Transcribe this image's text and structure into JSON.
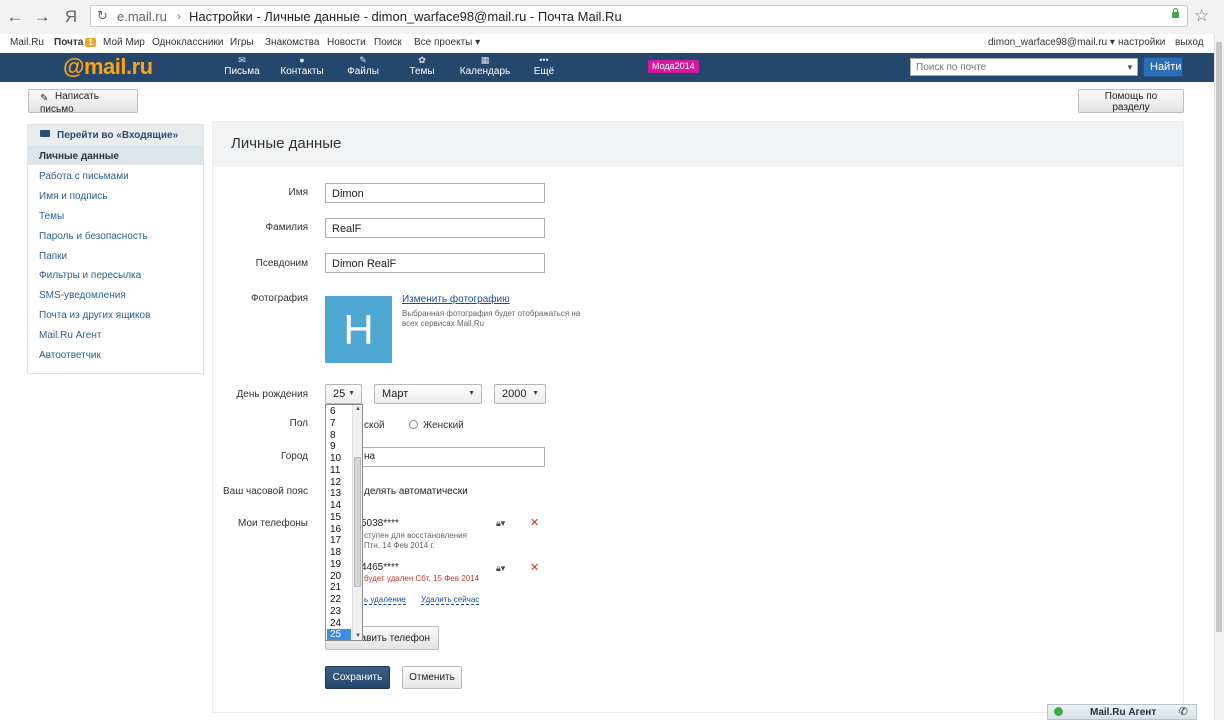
{
  "browser": {
    "url": "e.mail.ru",
    "separator": "›",
    "tab_title": "Настройки - Личные данные - dimon_warface98@mail.ru - Почта Mail.Ru",
    "back_glyph": "←",
    "forward_glyph": "→",
    "yandex_glyph": "Я",
    "reload_glyph": "↻",
    "star_glyph": "☆"
  },
  "portal": {
    "links": [
      "Mail.Ru",
      "Почта",
      "Мой Мир",
      "Одноклассники",
      "Игры",
      "Знакомства",
      "Новости",
      "Поиск",
      "Все проекты ▾"
    ],
    "mail_badge": "1",
    "user": "dimon_warface98@mail.ru ▾",
    "settings": "настройки",
    "logout": "выход"
  },
  "header": {
    "logo": "@mail.ru",
    "nav": [
      {
        "label": "Письма",
        "icon": "✉"
      },
      {
        "label": "Контакты",
        "icon": "●"
      },
      {
        "label": "Файлы",
        "icon": "✎"
      },
      {
        "label": "Темы",
        "icon": "✿"
      },
      {
        "label": "Календарь",
        "icon": "▦"
      },
      {
        "label": "Ещё",
        "icon": "•••"
      }
    ],
    "promo": "Мода2014",
    "search_placeholder": "Поиск по почте",
    "search_button": "Найти"
  },
  "toolbar": {
    "compose": "Написать письмо",
    "help": "Помощь по разделу"
  },
  "sidebar": {
    "inbox": "Перейти во «Входящие»",
    "items": [
      "Личные данные",
      "Работа с письмами",
      "Имя и подпись",
      "Темы",
      "Пароль и безопасность",
      "Папки",
      "Фильтры и пересылка",
      "SMS-уведомления",
      "Почта из других ящиков",
      "Mail.Ru Агент",
      "Автоответчик"
    ]
  },
  "form": {
    "title": "Личные данные",
    "first_name_label": "Имя",
    "first_name": "Dimon",
    "last_name_label": "Фамилия",
    "last_name": "RealF",
    "nickname_label": "Псевдоним",
    "nickname": "Dimon RealF",
    "photo_label": "Фотография",
    "photo_letter": "H",
    "change_photo": "Изменить фотографию",
    "photo_hint": "Выбранная фотография будет отображаться на всех сервисах Mail.Ru",
    "birthday_label": "День рождения",
    "day": "25",
    "month": "Март",
    "year": "2000",
    "gender_label": "Пол",
    "gender_male_partial": "ской",
    "gender_female": "Женский",
    "city_label": "Город",
    "city_partial": "на",
    "timezone_label": "Ваш часовой пояс",
    "timezone_value_partial": "делять автоматически",
    "phones_label": "Мои телефоны",
    "phone1": "5038****",
    "phone1_sub1": "ступен для восстановления",
    "phone1_sub2": "Птн, 14 Фев 2014 г.",
    "phone2": "4465****",
    "phone2_warn": "будет удален Сбт, 15 Фев 2014",
    "cancel_delete_partial": "ь удаление",
    "delete_now": "Удалить сейчас",
    "add_phone_partial": "бавить телефон",
    "save": "Сохранить",
    "cancel": "Отменить"
  },
  "day_dropdown": {
    "options": [
      "6",
      "7",
      "8",
      "9",
      "10",
      "11",
      "12",
      "13",
      "14",
      "15",
      "16",
      "17",
      "18",
      "19",
      "20",
      "21",
      "22",
      "23",
      "24",
      "25"
    ],
    "selected": "25"
  },
  "agent": {
    "label": "Mail.Ru Агент",
    "phone_glyph": "✆"
  },
  "colors": {
    "header_bg": "#25476b",
    "logo": "#f9a21a",
    "promo": "#d41a9f",
    "link": "#2b5f8f",
    "selected_option": "#3a8ee6",
    "danger": "#c0392b"
  }
}
